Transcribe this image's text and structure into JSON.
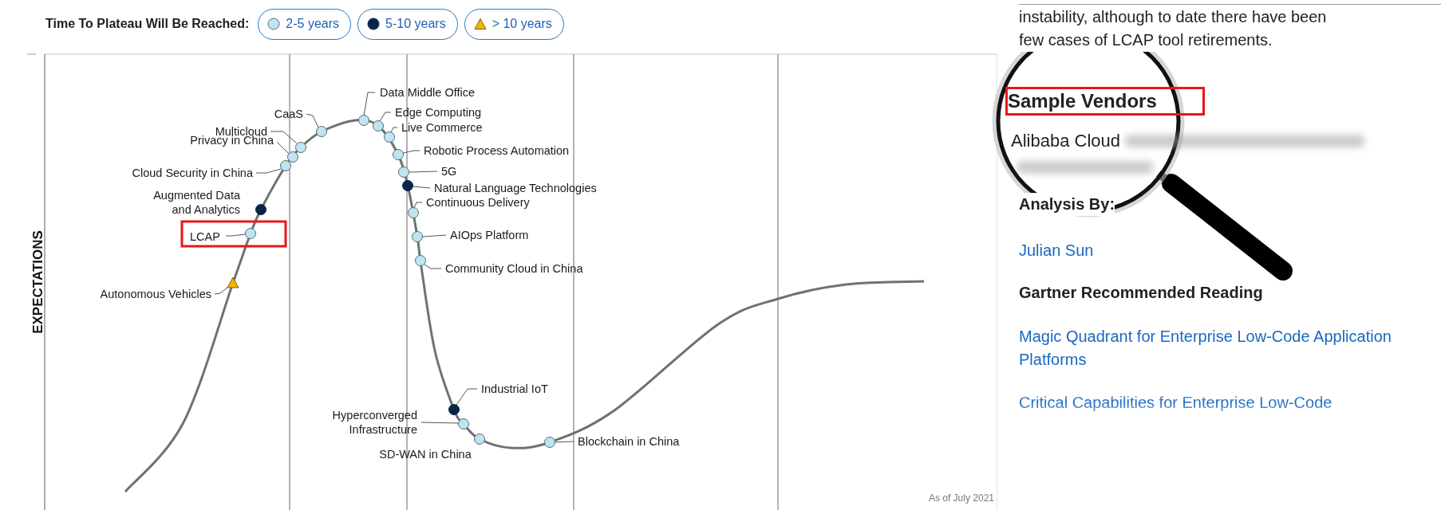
{
  "legend": {
    "title": "Time To Plateau Will Be Reached:",
    "items": [
      {
        "kind": "short",
        "label": "2-5 years"
      },
      {
        "kind": "medium",
        "label": "5-10 years"
      },
      {
        "kind": "long",
        "label": "> 10 years"
      }
    ]
  },
  "hype_cycle": {
    "axis_label": "EXPECTATIONS",
    "date_note": "As of July 2021",
    "technologies": [
      {
        "lines": [
          "Data Middle Office"
        ],
        "kind": "short",
        "highlighted": false
      },
      {
        "lines": [
          "CaaS"
        ],
        "kind": "short",
        "highlighted": false
      },
      {
        "lines": [
          "Edge Computing"
        ],
        "kind": "short",
        "highlighted": false
      },
      {
        "lines": [
          "Live Commerce"
        ],
        "kind": "short",
        "highlighted": false
      },
      {
        "lines": [
          "Multicloud"
        ],
        "kind": "short",
        "highlighted": false
      },
      {
        "lines": [
          "Privacy in China"
        ],
        "kind": "short",
        "highlighted": false
      },
      {
        "lines": [
          "Robotic Process Automation"
        ],
        "kind": "short",
        "highlighted": false
      },
      {
        "lines": [
          "5G"
        ],
        "kind": "short",
        "highlighted": false
      },
      {
        "lines": [
          "Cloud Security in China"
        ],
        "kind": "short",
        "highlighted": false
      },
      {
        "lines": [
          "Natural Language Technologies"
        ],
        "kind": "medium",
        "highlighted": false
      },
      {
        "lines": [
          "Augmented Data",
          "and Analytics"
        ],
        "kind": "medium",
        "highlighted": false
      },
      {
        "lines": [
          "Continuous Delivery"
        ],
        "kind": "short",
        "highlighted": false
      },
      {
        "lines": [
          "LCAP"
        ],
        "kind": "short",
        "highlighted": true
      },
      {
        "lines": [
          "AIOps Platform"
        ],
        "kind": "short",
        "highlighted": false
      },
      {
        "lines": [
          "Community Cloud in China"
        ],
        "kind": "short",
        "highlighted": false
      },
      {
        "lines": [
          "Autonomous Vehicles"
        ],
        "kind": "long",
        "highlighted": false
      },
      {
        "lines": [
          "Industrial IoT"
        ],
        "kind": "medium",
        "highlighted": false
      },
      {
        "lines": [
          "Hyperconverged",
          "Infrastructure"
        ],
        "kind": "short",
        "highlighted": false
      },
      {
        "lines": [
          "Blockchain in China"
        ],
        "kind": "short",
        "highlighted": false
      },
      {
        "lines": [
          "SD-WAN in China"
        ],
        "kind": "short",
        "highlighted": false
      }
    ]
  },
  "article": {
    "intro": "instability, although to date there have been few cases of LCAP tool retirements.",
    "sample_vendors": {
      "heading": "Sample Vendors",
      "highlighted": true,
      "visible_vendor": "Alibaba Cloud"
    },
    "analysis_by": {
      "heading": "Analysis By:",
      "analyst": "Julian Sun"
    },
    "recommended_reading": {
      "heading": "Gartner Recommended Reading",
      "links": [
        {
          "label": "Magic Quadrant for Enterprise Low-Code Application Platforms",
          "faded": false
        },
        {
          "label": "Critical Capabilities for Enterprise Low-Code",
          "faded": true
        }
      ]
    }
  }
}
